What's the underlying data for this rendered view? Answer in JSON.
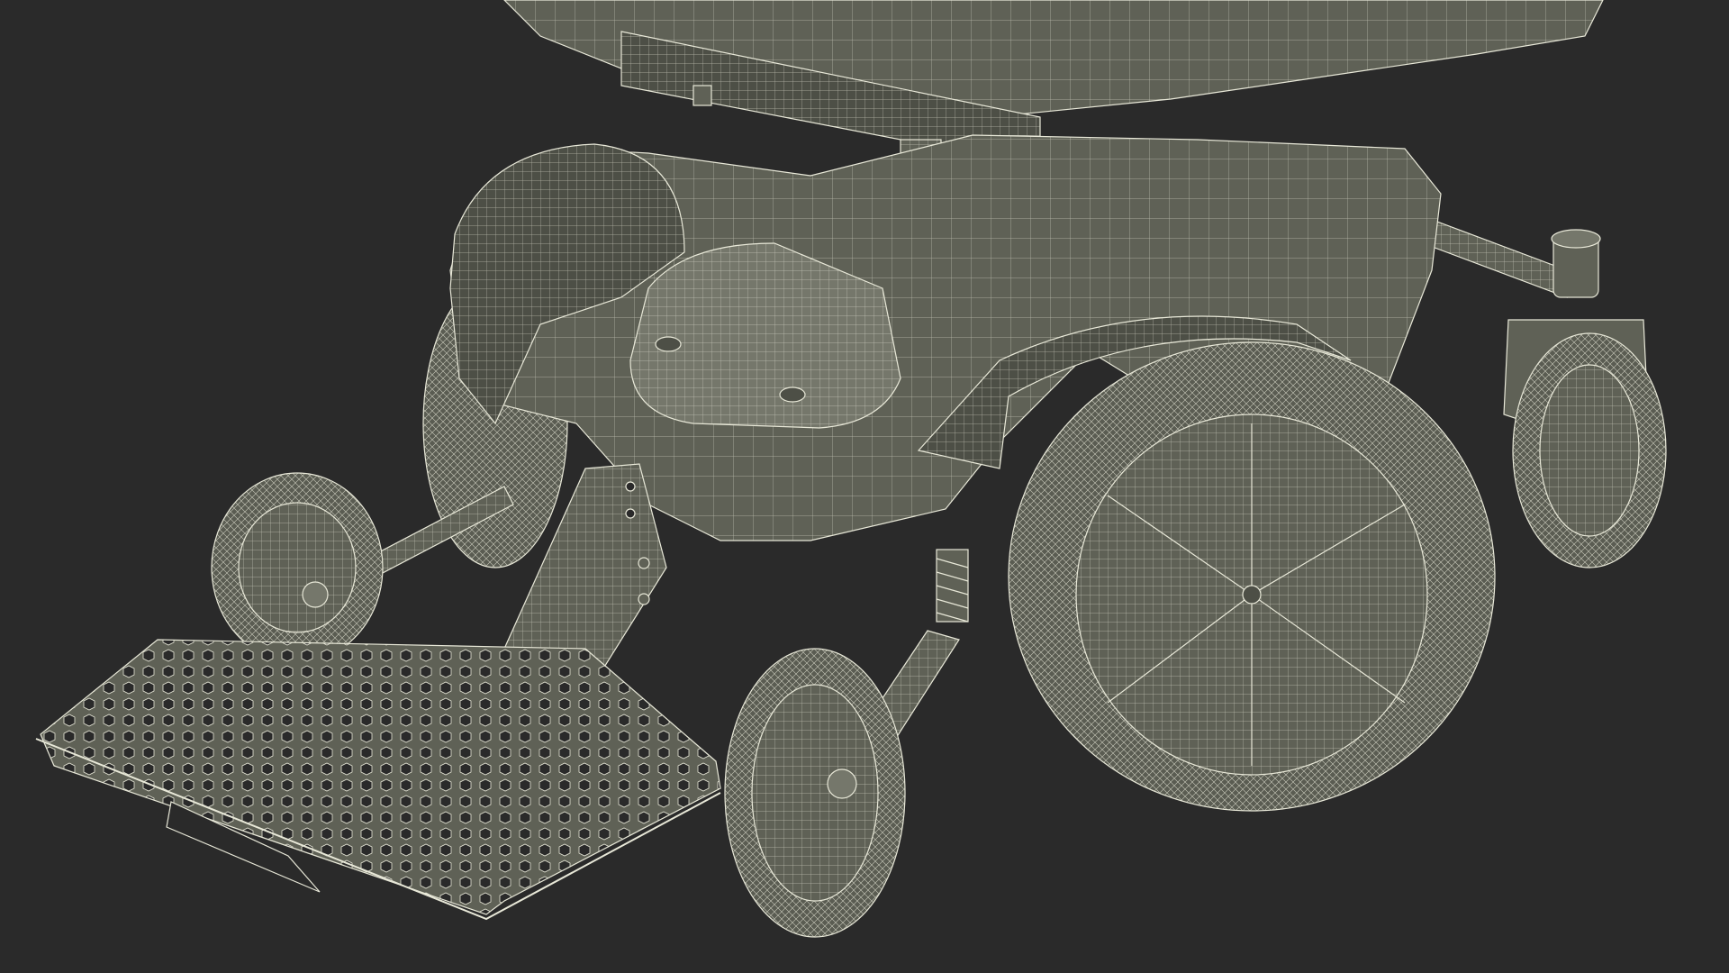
{
  "scene": {
    "subject": "power-wheelchair-wireframe-render",
    "colors": {
      "background": "#2a2a2a",
      "body": "#5f6156",
      "body_dark": "#4d4f46",
      "body_light": "#75776b",
      "wire": "#e8e8d8"
    }
  }
}
